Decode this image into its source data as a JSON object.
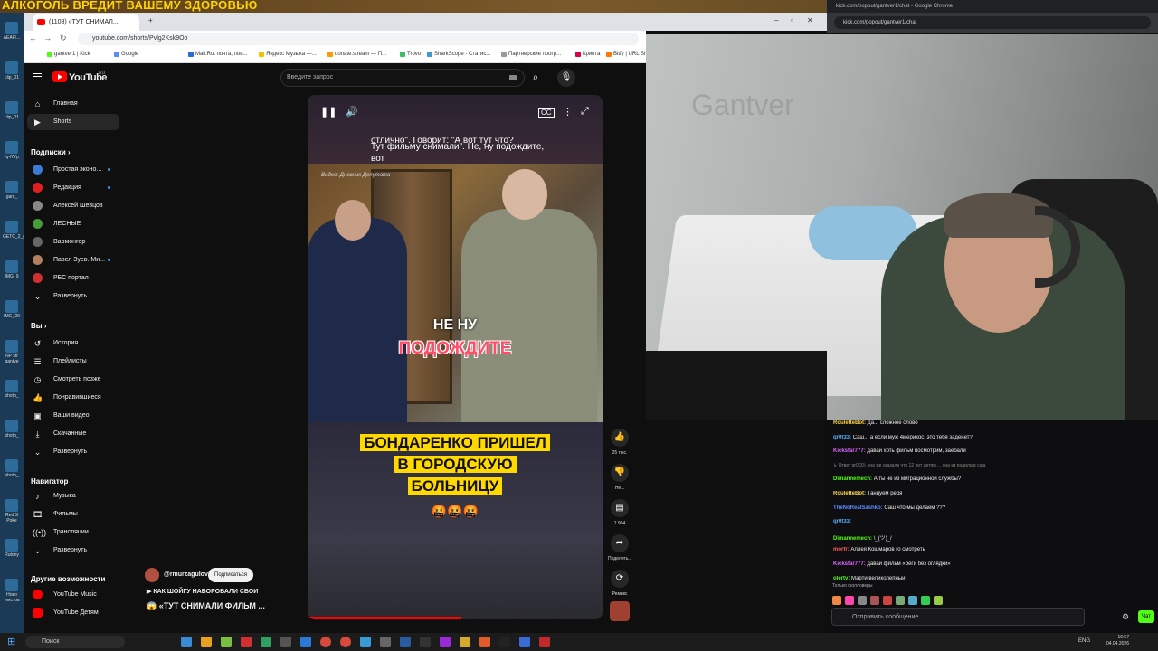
{
  "banner": {
    "text": "АЛКОГОЛЬ ВРЕДИТ ВАШЕМУ ЗДОРОВЬЮ"
  },
  "browser_left": {
    "tab_title": "(1108) «ТУТ СНИМАЛ...",
    "url": "youtube.com/shorts/Pvlg2Ksk9Oo",
    "bookmarks": [
      "gantver1 | Kick",
      "Google",
      "Mail.Ru: почта, пои...",
      "Яндекс Музыка —...",
      "donate.stream — П...",
      "Trovo",
      "SharkScope - Статис...",
      "Партнерские прогр...",
      "Криптa",
      "Bitfy | URL Sh"
    ]
  },
  "youtube": {
    "logo": "YouTube",
    "logo_region": "RU",
    "search_placeholder": "Введите запрос",
    "nav": [
      {
        "label": "Главная",
        "icon": "home-icon"
      },
      {
        "label": "Shorts",
        "icon": "shorts-icon"
      }
    ],
    "subs_heading": "Подписки",
    "subs": [
      {
        "label": "Простая эконо...",
        "color": "#3a7bd5",
        "dot": true
      },
      {
        "label": "Редакция",
        "color": "#e02020",
        "dot": true
      },
      {
        "label": "Алексей Шевцов",
        "color": "#888888",
        "dot": false
      },
      {
        "label": "ЛЕСНЫЕ",
        "color": "#4a9a3a",
        "dot": false
      },
      {
        "label": "Вармонгер",
        "color": "#666666",
        "dot": false
      },
      {
        "label": "Павел Зуев. Ми...",
        "color": "#b08060",
        "dot": true
      },
      {
        "label": "РБС портал",
        "color": "#d03030",
        "dot": false
      }
    ],
    "expand": "Развернуть",
    "you_heading": "Вы",
    "you_items": [
      {
        "label": "История",
        "icon": "history-icon"
      },
      {
        "label": "Плейлисты",
        "icon": "playlist-icon"
      },
      {
        "label": "Смотреть позже",
        "icon": "watch-later-icon"
      },
      {
        "label": "Понравившиеся",
        "icon": "like-icon"
      },
      {
        "label": "Ваши видео",
        "icon": "your-videos-icon"
      },
      {
        "label": "Скачанные",
        "icon": "download-icon"
      },
      {
        "label": "Развернуть",
        "icon": "chevron-down-icon"
      }
    ],
    "nav_heading": "Навигатор",
    "nav2": [
      {
        "label": "Музыка",
        "icon": "music-icon"
      },
      {
        "label": "Фильмы",
        "icon": "film-icon"
      },
      {
        "label": "Трансляции",
        "icon": "live-icon"
      },
      {
        "label": "Развернуть",
        "icon": "chevron-down-icon"
      }
    ],
    "more_heading": "Другие возможности",
    "more": [
      {
        "label": "YouTube Music"
      },
      {
        "label": "YouTube Детям"
      }
    ],
    "video": {
      "subtitle_line1": "отлично\". Говорит: \"А вот тут что?",
      "subtitle_line2": "Тут фильму снимали\". Не, ну подождите,",
      "subtitle_line3": "вот",
      "watermark": "Видео: Дневник Депутата",
      "caption_top": "НЕ НУ",
      "caption_bottom": "ПОДОЖДИТЕ",
      "headline": [
        "БОНДАРЕНКО ПРИШЕЛ",
        "В ГОРОДСКУЮ",
        "БОЛЬНИЦУ"
      ],
      "emoji": "🤬🤬🤬",
      "progress": 0.52
    },
    "actions": [
      {
        "icon": "like-icon",
        "label": "25 тыс."
      },
      {
        "icon": "dislike-icon",
        "label": "Не..."
      },
      {
        "icon": "comment-icon",
        "label": "1 904"
      },
      {
        "icon": "share-icon",
        "label": "Поделить..."
      },
      {
        "icon": "remix-icon",
        "label": "Ремикс"
      }
    ],
    "channel": {
      "name": "@rmurzagulov",
      "subscribe": "Подписаться"
    },
    "video_line1": "КАК ШОЙГУ НАВОРОВАЛИ СВОИ",
    "video_line2": "«ТУТ СНИМАЛИ ФИЛЬМ ..."
  },
  "kick": {
    "tab_title": "kick.com/popout/gantver1/chat - Google Chrome",
    "url": "kick.com/popout/gantver1/chat",
    "wall_text": "Gantver",
    "messages": [
      {
        "user": "RouletteBot",
        "color": "#ffd84d",
        "text": "Да... сложное слово"
      },
      {
        "user": "qr0t33",
        "color": "#5ab0ff",
        "text": "Саш... а если муж 4мерикос, это тебя заденет?"
      },
      {
        "user": "Kickstar777",
        "color": "#e066ff",
        "text": "давай хоть фильм посмотрим, заебали"
      },
      {
        "user": "",
        "color": "#888888",
        "text": "↳ Ответ qr0t33: она же сказала что 12 лет детям ... она из родила в сша",
        "reply": true
      },
      {
        "user": "Dimannemech",
        "color": "#53fc18",
        "text": "А ты че из миграционной службы?"
      },
      {
        "user": "RouletteBot",
        "color": "#ffd84d",
        "text": "Танцуем ребя"
      },
      {
        "user": "TheNoRealSashko",
        "color": "#5a8bff",
        "text": "Саш что мы делаем ???"
      },
      {
        "user": "qr0t33",
        "color": "#5ab0ff",
        "text": ""
      },
      {
        "user": "Dimannemech",
        "color": "#53fc18",
        "text": "\\_(ツ)_/"
      },
      {
        "user": "morfr",
        "color": "#ff5a5a",
        "text": "Аллея Кошмаров го смотреть"
      },
      {
        "user": "Kickstar777",
        "color": "#e066ff",
        "text": "давай фильм «беги без оглядки»"
      },
      {
        "user": "olertv",
        "color": "#53fc18",
        "text": "Марти великолепный"
      }
    ],
    "followers_only": "Только фолловеры",
    "input_placeholder": "Отправить сообщение",
    "send": "Чат"
  },
  "taskbar": {
    "search": "Поиск",
    "lang": "ENG",
    "time": "16:57",
    "date": "04.04.2026"
  },
  "desktop_icons": [
    "AEAF\\...",
    "clip_01",
    "clip_01",
    "fq-f7Yp",
    "gant_",
    "GETC_2_gant",
    "IMG_9",
    "IMG_20",
    "NP str gantve",
    "photo_",
    "photo_",
    "photo_",
    "Red S Poke",
    "Rutony",
    "Ново текстов"
  ]
}
